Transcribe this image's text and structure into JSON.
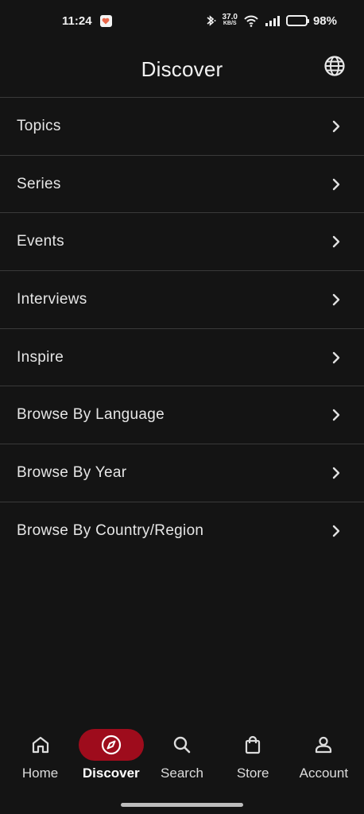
{
  "status_bar": {
    "time": "11:24",
    "net_speed_value": "37.0",
    "net_speed_unit": "KB/S",
    "battery": "98%",
    "icons": [
      "notification-heart-icon",
      "bluetooth-icon",
      "wifi-icon",
      "signal-icon",
      "battery-icon"
    ]
  },
  "header": {
    "title": "Discover",
    "language_icon": "globe-icon"
  },
  "menu": {
    "items": [
      {
        "label": "Topics"
      },
      {
        "label": "Series"
      },
      {
        "label": "Events"
      },
      {
        "label": "Interviews"
      },
      {
        "label": "Inspire"
      },
      {
        "label": "Browse By Language"
      },
      {
        "label": "Browse By Year"
      },
      {
        "label": "Browse By Country/Region"
      }
    ],
    "trailing_icon": "chevron-right-icon"
  },
  "bottom_nav": {
    "items": [
      {
        "label": "Home",
        "icon": "home-icon"
      },
      {
        "label": "Discover",
        "icon": "compass-icon",
        "active": true
      },
      {
        "label": "Search",
        "icon": "search-icon"
      },
      {
        "label": "Store",
        "icon": "shopping-bag-icon"
      },
      {
        "label": "Account",
        "icon": "person-icon"
      }
    ]
  },
  "colors": {
    "background": "#141414",
    "divider": "#3a3a3a",
    "accent": "#9e0c1c",
    "text": "#e6e6e6"
  }
}
